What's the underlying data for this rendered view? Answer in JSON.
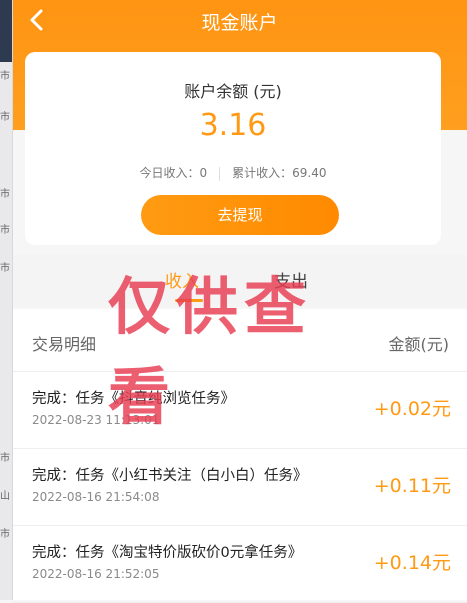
{
  "header": {
    "back_icon": "chevron-left-icon",
    "title": "现金账户"
  },
  "side_strip": {
    "labels": [
      "市",
      "市",
      "市",
      "市",
      "市",
      "市",
      "山",
      "市"
    ]
  },
  "account": {
    "balance_label": "账户余额 (元)",
    "balance": "3.16",
    "today_income": "今日收入：0",
    "total_income": "累计收入：69.40",
    "withdraw_button": "去提现"
  },
  "tabs": [
    {
      "label": "收入",
      "active": true
    },
    {
      "label": "支出",
      "active": false
    }
  ],
  "watermark": "仅供查看",
  "list": {
    "header_left": "交易明细",
    "header_right": "金额(元)",
    "rows": [
      {
        "desc": "完成：任务《抖音纯浏览任务》",
        "time": "2022-08-23 11:13:01",
        "amount": "+0.02元"
      },
      {
        "desc": "完成：任务《小红书关注（白小白）任务》",
        "time": "2022-08-16 21:54:08",
        "amount": "+0.11元"
      },
      {
        "desc": "完成：任务《淘宝特价版砍价0元拿任务》",
        "time": "2022-08-16 21:52:05",
        "amount": "+0.14元"
      }
    ]
  },
  "colors": {
    "accent": "#ff9a14",
    "header": "#ff9412",
    "watermark": "#e63c50"
  }
}
